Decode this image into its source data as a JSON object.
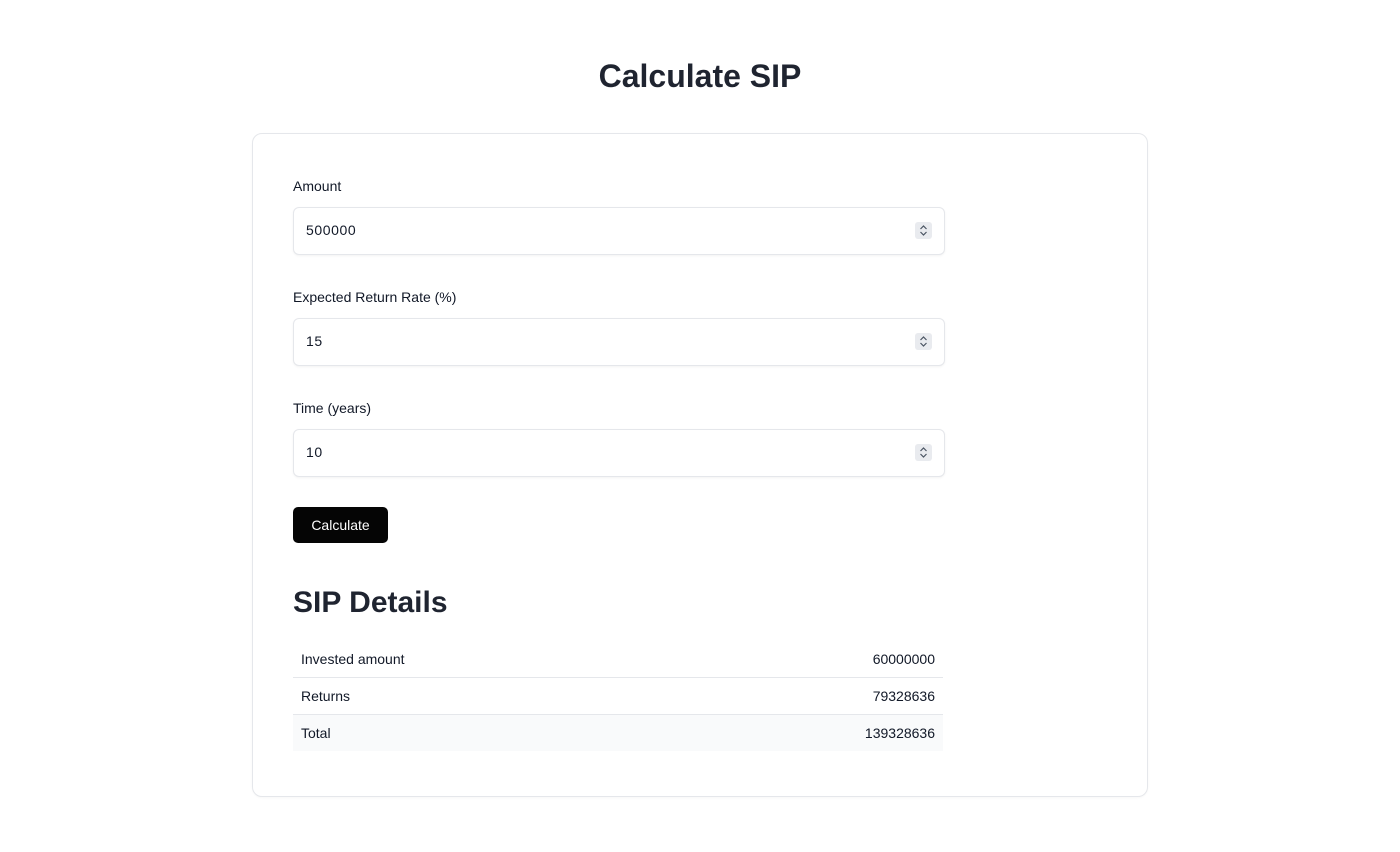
{
  "header": {
    "title": "Calculate SIP"
  },
  "form": {
    "amount": {
      "label": "Amount",
      "value": "500000"
    },
    "rate": {
      "label": "Expected Return Rate (%)",
      "value": "15"
    },
    "time": {
      "label": "Time (years)",
      "value": "10"
    },
    "calculate_label": "Calculate"
  },
  "details": {
    "title": "SIP Details",
    "rows": [
      {
        "label": "Invested amount",
        "value": "60000000"
      },
      {
        "label": "Returns",
        "value": "79328636"
      },
      {
        "label": "Total",
        "value": "139328636"
      }
    ]
  },
  "icons": {
    "stepper": "chevron-up-down-icon"
  },
  "colors": {
    "button_bg": "#050505",
    "heading": "#1f2430",
    "border": "#e5e7eb"
  }
}
